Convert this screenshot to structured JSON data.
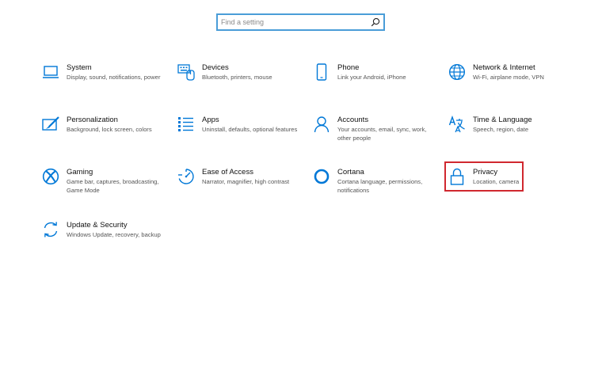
{
  "search": {
    "placeholder": "Find a setting",
    "icon": "search-icon"
  },
  "accent_color": "#0078d7",
  "highlight_color": "#d0282f",
  "tiles": [
    {
      "title": "System",
      "desc": "Display, sound, notifications, power",
      "icon": "laptop-icon"
    },
    {
      "title": "Devices",
      "desc": "Bluetooth, printers, mouse",
      "icon": "keyboard-icon"
    },
    {
      "title": "Phone",
      "desc": "Link your Android, iPhone",
      "icon": "phone-icon"
    },
    {
      "title": "Network & Internet",
      "desc": "Wi-Fi, airplane mode, VPN",
      "icon": "globe-icon"
    },
    {
      "title": "Personalization",
      "desc": "Background, lock screen, colors",
      "icon": "paintbrush-icon"
    },
    {
      "title": "Apps",
      "desc": "Uninstall, defaults, optional features",
      "icon": "apps-list-icon"
    },
    {
      "title": "Accounts",
      "desc": "Your accounts, email, sync, work, other people",
      "icon": "person-icon"
    },
    {
      "title": "Time & Language",
      "desc": "Speech, region, date",
      "icon": "time-language-icon"
    },
    {
      "title": "Gaming",
      "desc": "Game bar, captures, broadcasting, Game Mode",
      "icon": "xbox-icon"
    },
    {
      "title": "Ease of Access",
      "desc": "Narrator, magnifier, high contrast",
      "icon": "ease-of-access-icon"
    },
    {
      "title": "Cortana",
      "desc": "Cortana language, permissions, notifications",
      "icon": "cortana-icon"
    },
    {
      "title": "Privacy",
      "desc": "Location, camera",
      "icon": "lock-icon"
    },
    {
      "title": "Update & Security",
      "desc": "Windows Update, recovery, backup",
      "icon": "sync-icon"
    }
  ]
}
